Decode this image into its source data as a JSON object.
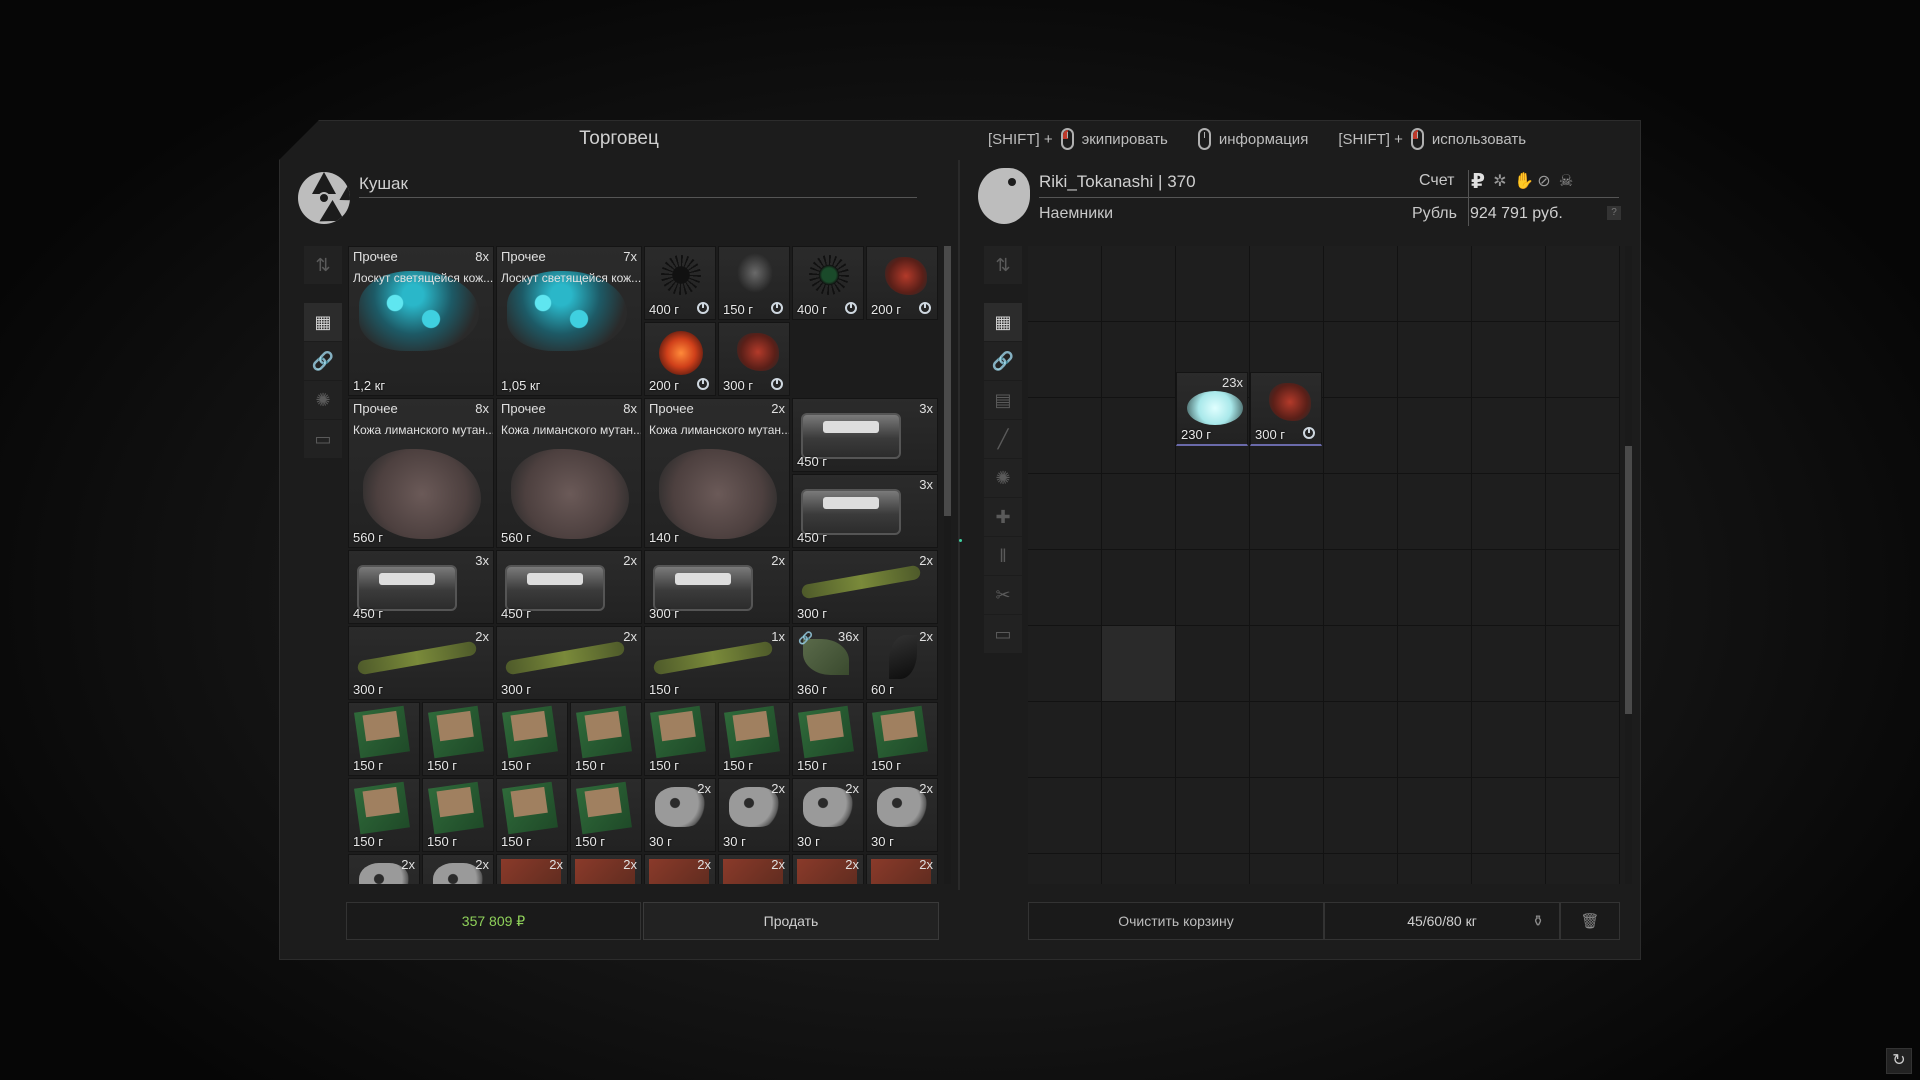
{
  "trader": {
    "title": "Торговец",
    "name": "Кушак",
    "sum": "357 809 ₽",
    "sell_label": "Продать"
  },
  "hints": [
    {
      "prefix": "[SHIFT] +",
      "label": "экипировать"
    },
    {
      "prefix": "",
      "label": "информация"
    },
    {
      "prefix": "[SHIFT] +",
      "label": "использовать"
    }
  ],
  "player": {
    "name": "Riki_Tokanashi | 370",
    "group": "Наемники",
    "account_label": "Счет",
    "currency_label": "Рубль",
    "balance": "924 791 руб.",
    "clear_label": "Очистить корзину",
    "weight": "45/60/80 кг",
    "help": "?"
  },
  "colors": {
    "accent_sum": "#8fd15a",
    "bg": "#1c1c1c"
  },
  "icons": [
    "ruble-icon",
    "sun-icon",
    "hand-icon",
    "slash-icon",
    "skull-icon",
    "kettlebell-icon",
    "trash-icon"
  ],
  "trader_items": [
    {
      "cat": "Прочее",
      "name": "Лоскут светящейся кож...",
      "count": "8x",
      "weight": "1,2 кг"
    },
    {
      "cat": "Прочее",
      "name": "Лоскут светящейся кож...",
      "count": "7x",
      "weight": "1,05 кг"
    },
    {
      "weight": "400 г"
    },
    {
      "weight": "150 г"
    },
    {
      "weight": "400 г"
    },
    {
      "weight": "200 г"
    },
    {
      "weight": "200 г"
    },
    {
      "weight": "300 г"
    },
    {
      "cat": "Прочее",
      "name": "Кожа лиманского мутан...",
      "count": "8x",
      "weight": "560 г"
    },
    {
      "cat": "Прочее",
      "name": "Кожа лиманского мутан...",
      "count": "8x",
      "weight": "560 г"
    },
    {
      "cat": "Прочее",
      "name": "Кожа лиманского мутан...",
      "count": "2x",
      "weight": "140 г"
    },
    {
      "count": "3x",
      "weight": "450 г"
    },
    {
      "count": "3x",
      "weight": "450 г"
    },
    {
      "count": "3x",
      "weight": "450 г"
    },
    {
      "count": "2x",
      "weight": "450 г"
    },
    {
      "count": "2x",
      "weight": "300 г"
    },
    {
      "count": "2x",
      "weight": "300 г"
    },
    {
      "count": "2x",
      "weight": "300 г"
    },
    {
      "count": "2x",
      "weight": "300 г"
    },
    {
      "count": "1x",
      "weight": "150 г"
    },
    {
      "count": "36x",
      "weight": "360 г"
    },
    {
      "count": "2x",
      "weight": "60 г"
    },
    {
      "weight": "150 г"
    },
    {
      "weight": "150 г"
    },
    {
      "weight": "150 г"
    },
    {
      "weight": "150 г"
    },
    {
      "weight": "150 г"
    },
    {
      "weight": "150 г"
    },
    {
      "weight": "150 г"
    },
    {
      "weight": "150 г"
    },
    {
      "weight": "150 г"
    },
    {
      "weight": "150 г"
    },
    {
      "weight": "150 г"
    },
    {
      "weight": "150 г"
    },
    {
      "count": "2x",
      "weight": "30 г"
    },
    {
      "count": "2x",
      "weight": "30 г"
    },
    {
      "count": "2x",
      "weight": "30 г"
    },
    {
      "count": "2x",
      "weight": "30 г"
    },
    {
      "count": "2x"
    },
    {
      "count": "2x"
    },
    {
      "count": "2x"
    },
    {
      "count": "2x"
    },
    {
      "count": "2x"
    },
    {
      "count": "2x"
    },
    {
      "count": "2x"
    },
    {
      "count": "2x"
    }
  ],
  "player_items": [
    {
      "count": "23x",
      "weight": "230 г"
    },
    {
      "weight": "300 г"
    }
  ]
}
